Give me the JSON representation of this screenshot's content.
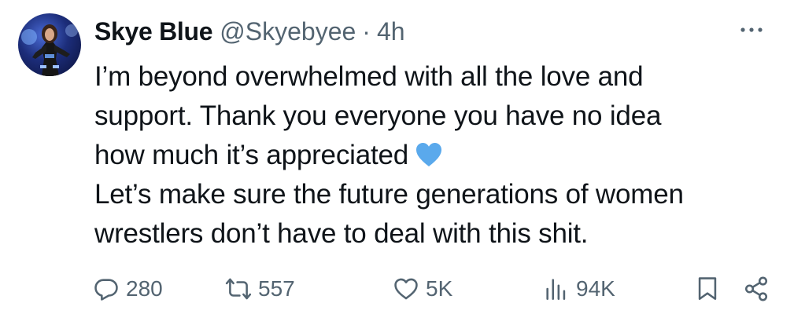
{
  "tweet": {
    "author": {
      "name": "Skye Blue",
      "handle": "@Skyebyee",
      "separator": "·",
      "time": "4h"
    },
    "text_lines": [
      "I’m beyond overwhelmed with all the love and",
      "support. Thank you everyone you have no idea",
      "how much it’s appreciated",
      "Let’s make sure the future generations of women",
      "wrestlers don’t have to deal with this shit."
    ],
    "emoji": "blue-heart",
    "actions": {
      "replies": "280",
      "retweets": "557",
      "likes": "5K",
      "views": "94K"
    }
  },
  "colors": {
    "text": "#0f1419",
    "secondary": "#536471",
    "heart": "#5aa9ec"
  },
  "icons": [
    "more-icon",
    "reply-icon",
    "retweet-icon",
    "like-icon",
    "views-icon",
    "bookmark-icon",
    "share-icon"
  ]
}
